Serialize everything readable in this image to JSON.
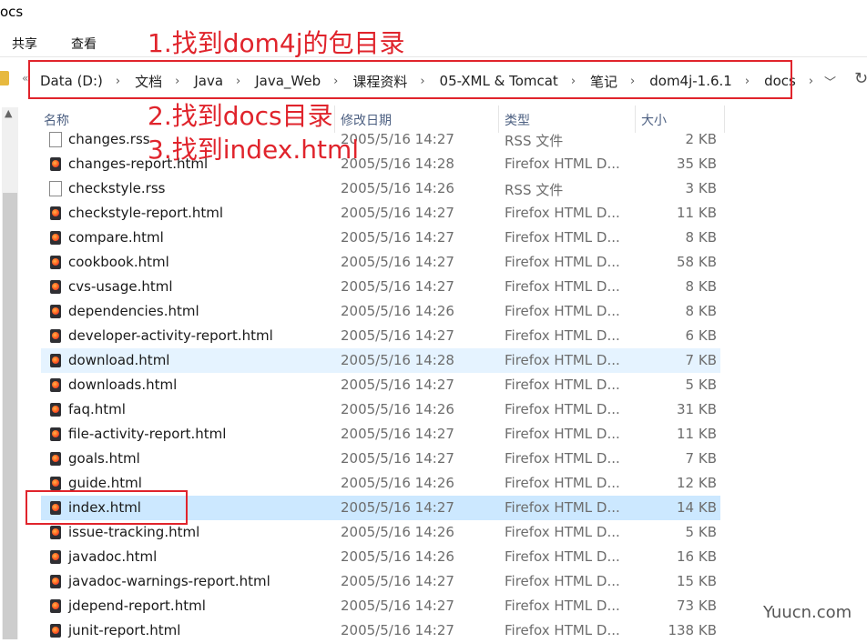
{
  "window": {
    "title": "ocs"
  },
  "ribbon": {
    "share": "共享",
    "view": "查看"
  },
  "address": {
    "segments": [
      "Data (D:)",
      "文档",
      "Java",
      "Java_Web",
      "课程资料",
      "05-XML & Tomcat",
      "笔记",
      "dom4j-1.6.1",
      "docs"
    ]
  },
  "columns": {
    "name": "名称",
    "date": "修改日期",
    "type": "类型",
    "size": "大小"
  },
  "files": [
    {
      "name": "changes.rss",
      "date": "2005/5/16 14:27",
      "type": "RSS 文件",
      "size": "2 KB",
      "icon": "rss-file-icon"
    },
    {
      "name": "changes-report.html",
      "date": "2005/5/16 14:28",
      "type": "Firefox HTML D...",
      "size": "35 KB",
      "icon": "firefox-html-icon"
    },
    {
      "name": "checkstyle.rss",
      "date": "2005/5/16 14:26",
      "type": "RSS 文件",
      "size": "3 KB",
      "icon": "rss-file-icon"
    },
    {
      "name": "checkstyle-report.html",
      "date": "2005/5/16 14:27",
      "type": "Firefox HTML D...",
      "size": "11 KB",
      "icon": "firefox-html-icon"
    },
    {
      "name": "compare.html",
      "date": "2005/5/16 14:27",
      "type": "Firefox HTML D...",
      "size": "8 KB",
      "icon": "firefox-html-icon"
    },
    {
      "name": "cookbook.html",
      "date": "2005/5/16 14:27",
      "type": "Firefox HTML D...",
      "size": "58 KB",
      "icon": "firefox-html-icon"
    },
    {
      "name": "cvs-usage.html",
      "date": "2005/5/16 14:27",
      "type": "Firefox HTML D...",
      "size": "8 KB",
      "icon": "firefox-html-icon"
    },
    {
      "name": "dependencies.html",
      "date": "2005/5/16 14:26",
      "type": "Firefox HTML D...",
      "size": "8 KB",
      "icon": "firefox-html-icon"
    },
    {
      "name": "developer-activity-report.html",
      "date": "2005/5/16 14:27",
      "type": "Firefox HTML D...",
      "size": "6 KB",
      "icon": "firefox-html-icon"
    },
    {
      "name": "download.html",
      "date": "2005/5/16 14:28",
      "type": "Firefox HTML D...",
      "size": "7 KB",
      "icon": "firefox-html-icon",
      "state": "hover"
    },
    {
      "name": "downloads.html",
      "date": "2005/5/16 14:27",
      "type": "Firefox HTML D...",
      "size": "5 KB",
      "icon": "firefox-html-icon"
    },
    {
      "name": "faq.html",
      "date": "2005/5/16 14:26",
      "type": "Firefox HTML D...",
      "size": "31 KB",
      "icon": "firefox-html-icon"
    },
    {
      "name": "file-activity-report.html",
      "date": "2005/5/16 14:27",
      "type": "Firefox HTML D...",
      "size": "11 KB",
      "icon": "firefox-html-icon"
    },
    {
      "name": "goals.html",
      "date": "2005/5/16 14:27",
      "type": "Firefox HTML D...",
      "size": "7 KB",
      "icon": "firefox-html-icon"
    },
    {
      "name": "guide.html",
      "date": "2005/5/16 14:26",
      "type": "Firefox HTML D...",
      "size": "12 KB",
      "icon": "firefox-html-icon"
    },
    {
      "name": "index.html",
      "date": "2005/5/16 14:27",
      "type": "Firefox HTML D...",
      "size": "14 KB",
      "icon": "firefox-html-icon",
      "state": "selected"
    },
    {
      "name": "issue-tracking.html",
      "date": "2005/5/16 14:26",
      "type": "Firefox HTML D...",
      "size": "5 KB",
      "icon": "firefox-html-icon"
    },
    {
      "name": "javadoc.html",
      "date": "2005/5/16 14:26",
      "type": "Firefox HTML D...",
      "size": "16 KB",
      "icon": "firefox-html-icon"
    },
    {
      "name": "javadoc-warnings-report.html",
      "date": "2005/5/16 14:27",
      "type": "Firefox HTML D...",
      "size": "15 KB",
      "icon": "firefox-html-icon"
    },
    {
      "name": "jdepend-report.html",
      "date": "2005/5/16 14:27",
      "type": "Firefox HTML D...",
      "size": "73 KB",
      "icon": "firefox-html-icon"
    },
    {
      "name": "junit-report.html",
      "date": "2005/5/16 14:27",
      "type": "Firefox HTML D...",
      "size": "138 KB",
      "icon": "firefox-html-icon"
    }
  ],
  "annotations": {
    "step1": "1.找到dom4j的包目录",
    "step2": "2.找到docs目录",
    "step3": "3.找到index.html",
    "color": "#e0242c"
  },
  "watermark": "Yuucn.com",
  "colors": {
    "hover_row": "#e5f3ff",
    "selected_row": "#cce8ff",
    "column_header": "#4d6082"
  }
}
